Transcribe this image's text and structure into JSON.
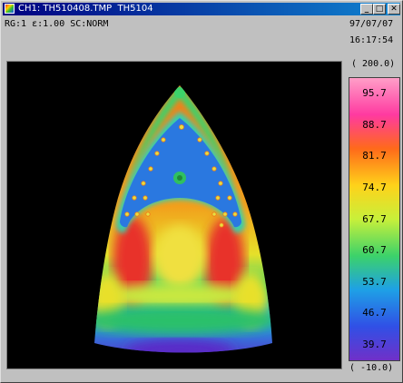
{
  "window": {
    "title": "CH1: TH510408.TMP  TH5104",
    "buttons": {
      "minimize": "_",
      "maximize": "□",
      "close": "✕"
    }
  },
  "status": {
    "range": "RG:1",
    "emissivity": "ε:1.00",
    "scale_mode": "SC:NORM",
    "date": "97/07/07",
    "time": "16:17:54"
  },
  "color_scale": {
    "max_label": "( 200.0)",
    "min_label": "( -10.0)",
    "levels": [
      "95.7",
      "88.7",
      "81.7",
      "74.7",
      "67.7",
      "60.7",
      "53.7",
      "46.7",
      "39.7"
    ],
    "colors": [
      "#ff9ec8",
      "#ff3aa0",
      "#ff6a1a",
      "#ffd21a",
      "#c8f03a",
      "#3cd26a",
      "#1ea0e6",
      "#3050e6",
      "#7030c8"
    ]
  },
  "icons": {
    "app": "thermal-camera-icon"
  }
}
